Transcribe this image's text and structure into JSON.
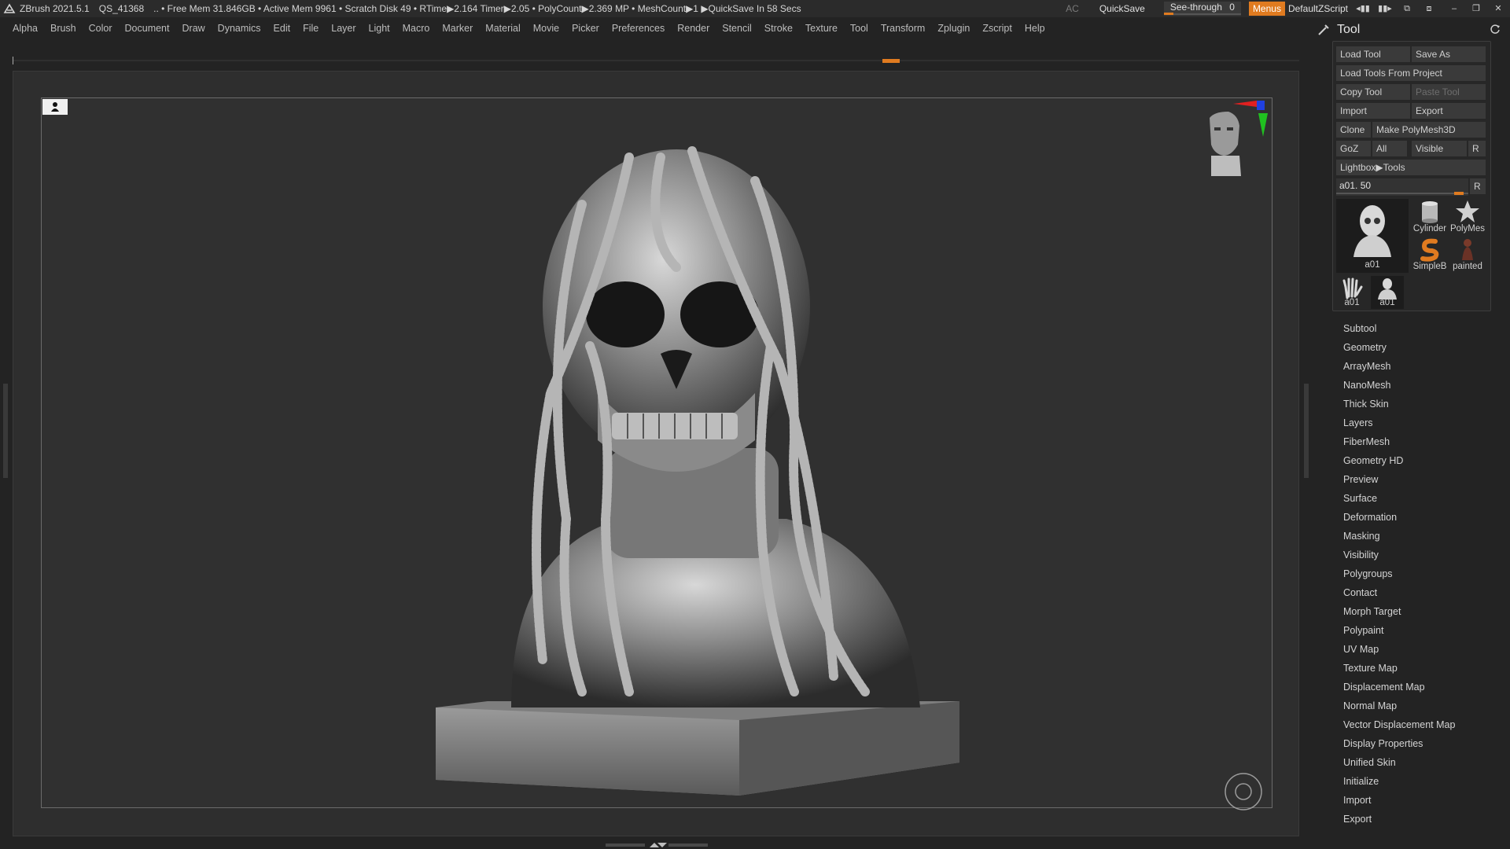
{
  "titlebar": {
    "app": "ZBrush 2021.5.1",
    "doc": "QS_41368",
    "status": ".. • Free Mem 31.846GB • Active Mem 9961 • Scratch Disk 49 • RTime▶2.164 Timer▶2.05 • PolyCount▶2.369 MP • MeshCount▶1 ▶QuickSave In 58 Secs",
    "ac": "AC",
    "quicksave": "QuickSave",
    "see_through_label": "See-through",
    "see_through_value": "0",
    "see_through_level": 0,
    "menus": "Menus",
    "script": "DefaultZScript"
  },
  "menubar": {
    "items": [
      "Alpha",
      "Brush",
      "Color",
      "Document",
      "Draw",
      "Dynamics",
      "Edit",
      "File",
      "Layer",
      "Light",
      "Macro",
      "Marker",
      "Material",
      "Movie",
      "Picker",
      "Preferences",
      "Render",
      "Stencil",
      "Stroke",
      "Texture",
      "Tool",
      "Transform",
      "Zplugin",
      "Zscript",
      "Help"
    ]
  },
  "colors": {
    "accent": "#e07b20",
    "background": "#232323",
    "canvas": "#303030"
  },
  "tool_panel": {
    "title": "Tool",
    "buttons": {
      "load_tool": "Load Tool",
      "save_as": "Save As",
      "load_from_project": "Load Tools From Project",
      "copy_tool": "Copy Tool",
      "paste_tool": "Paste Tool",
      "import": "Import",
      "export": "Export",
      "clone": "Clone",
      "make_polymesh": "Make PolyMesh3D",
      "goz": "GoZ",
      "all": "All",
      "visible": "Visible",
      "r": "R",
      "lightbox": "Lightbox▶Tools"
    },
    "slider": {
      "label": "a01. 50",
      "reset": "R"
    },
    "thumbnails": [
      {
        "name": "a01",
        "icon": "skull-bust-thumbnail"
      },
      {
        "name": "Cylinder",
        "icon": "cylinder-thumbnail"
      },
      {
        "name": "PolyMes",
        "icon": "polymesh-star-thumbnail"
      },
      {
        "name": "SimpleB",
        "icon": "simplebrush-thumbnail"
      },
      {
        "name": "painted",
        "icon": "painted-figure-thumbnail"
      },
      {
        "name": "a01",
        "icon": "hand-thumbnail"
      },
      {
        "name": "a01",
        "icon": "bust-thumbnail"
      }
    ],
    "subpalettes": [
      "Subtool",
      "Geometry",
      "ArrayMesh",
      "NanoMesh",
      "Thick Skin",
      "Layers",
      "FiberMesh",
      "Geometry HD",
      "Preview",
      "Surface",
      "Deformation",
      "Masking",
      "Visibility",
      "Polygroups",
      "Contact",
      "Morph Target",
      "Polypaint",
      "UV Map",
      "Texture Map",
      "Displacement Map",
      "Normal Map",
      "Vector Displacement Map",
      "Display Properties",
      "Unified Skin",
      "Initialize",
      "Import",
      "Export"
    ]
  }
}
